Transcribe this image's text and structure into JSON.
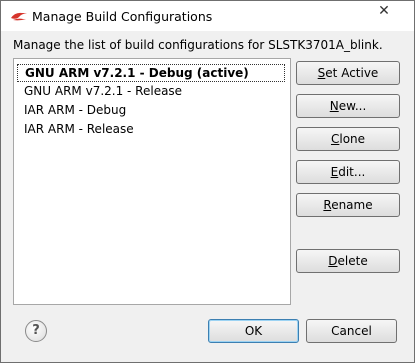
{
  "window": {
    "title": "Manage Build Configurations",
    "close_glyph": "✕"
  },
  "description": "Manage the list of build configurations for SLSTK3701A_blink.",
  "configurations": [
    {
      "label": "GNU ARM v7.2.1 - Debug (active)",
      "active": true
    },
    {
      "label": "GNU ARM v7.2.1 - Release",
      "active": false
    },
    {
      "label": "IAR ARM - Debug",
      "active": false
    },
    {
      "label": "IAR ARM - Release",
      "active": false
    }
  ],
  "buttons": {
    "set_active": {
      "mnemonic": "S",
      "rest": "et Active"
    },
    "new": {
      "mnemonic": "N",
      "rest": "ew..."
    },
    "clone": {
      "mnemonic": "C",
      "rest": "lone"
    },
    "edit": {
      "mnemonic": "E",
      "rest": "dit..."
    },
    "rename": {
      "mnemonic": "R",
      "rest": "ename"
    },
    "delete": {
      "mnemonic": "D",
      "rest": "elete"
    }
  },
  "footer": {
    "help_glyph": "?",
    "ok_label": "OK",
    "cancel_label": "Cancel"
  }
}
